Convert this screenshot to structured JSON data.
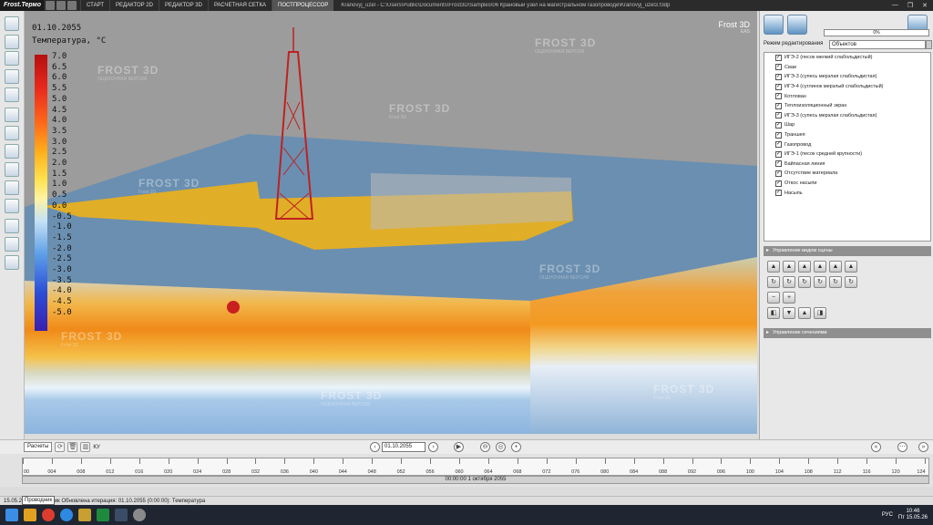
{
  "app": {
    "brand": "Frost.Термо",
    "window_title": "Kranovyj_uzel - C:\\Users\\Public\\Documents\\Frost3D\\Samples\\06 Крановый узел на магистральном газопроводе\\Kranovyj_uzel3.f3dp",
    "window_controls": [
      "—",
      "❐",
      "✕"
    ]
  },
  "tabs": [
    {
      "label": "СТАРТ"
    },
    {
      "label": "РЕДАКТОР 2D"
    },
    {
      "label": "РЕДАКТОР 3D"
    },
    {
      "label": "РАСЧЕТНАЯ СЕТКА"
    },
    {
      "label": "ПОСТПРОЦЕССОР"
    }
  ],
  "viewport": {
    "brand": "Frost 3D",
    "brand_sub": "EAS",
    "watermark": "FROST 3D",
    "watermark_sub1": "ОЦЕНОЧНАЯ ВЕРСИЯ",
    "watermark_sub2": "Frost 3D",
    "legend": {
      "date": "01.10.2055",
      "title": "Температура, °С",
      "ticks": [
        "7.0",
        "6.5",
        "6.0",
        "5.5",
        "5.0",
        "4.5",
        "4.0",
        "3.5",
        "3.0",
        "2.5",
        "2.0",
        "1.5",
        "1.0",
        "0.5",
        "0.0",
        "-0.5",
        "-1.0",
        "-1.5",
        "-2.0",
        "-2.5",
        "-3.0",
        "-3.5",
        "-4.0",
        "-4.5",
        "-5.0"
      ]
    }
  },
  "right_panel": {
    "progress": "0%",
    "mode_label": "Режим редактирования",
    "mode_value": "Объектов",
    "objects": [
      {
        "label": "ИГЭ-2 (песок мелкий слабольдистый)",
        "checked": true
      },
      {
        "label": "Сваи",
        "checked": true
      },
      {
        "label": "ИГЭ-3 (супесь мерзлая слабольдистая)",
        "checked": true
      },
      {
        "label": "ИГЭ-4 (суглинок мерзлый слабольдистый)",
        "checked": true
      },
      {
        "label": "Котлован",
        "checked": true
      },
      {
        "label": "Теплоизоляционный экран",
        "checked": true
      },
      {
        "label": "ИГЭ-3 (супесь мерзлая слабольдистая)",
        "checked": true
      },
      {
        "label": "Шар",
        "checked": true
      },
      {
        "label": "Траншея",
        "checked": true
      },
      {
        "label": "Газопровод",
        "checked": true
      },
      {
        "label": "ИГЭ-1 (песок средней крупности)",
        "checked": true
      },
      {
        "label": "Байпасная линия",
        "checked": true
      },
      {
        "label": "Отсутствие материала",
        "checked": true
      },
      {
        "label": "Откос насыпи",
        "checked": true
      },
      {
        "label": "Насыпь",
        "checked": true
      }
    ],
    "section_views": "Управление видом сцены",
    "section_cuts": "Управление сечениями"
  },
  "timebar": {
    "calc_label": "Расчеты",
    "date": "01.10.2055",
    "unit_label": "КУ"
  },
  "scale": {
    "labels": [
      "00",
      "004",
      "008",
      "012",
      "016",
      "020",
      "024",
      "028",
      "032",
      "036",
      "040",
      "044",
      "048",
      "052",
      "056",
      "060",
      "064",
      "068",
      "072",
      "076",
      "080",
      "084",
      "088",
      "092",
      "096",
      "100",
      "104",
      "108",
      "112",
      "116",
      "120",
      "124"
    ],
    "current": "00:00:00 1 октября 2055"
  },
  "status": {
    "text": "15.05.2026 Проводник  Обновлена итерация: 01.10.2055 (0:00:00): Температура",
    "tooltip": "Проводник"
  },
  "taskbar": {
    "lang": "РУС",
    "time": "10:46",
    "date": "Пт 15.05.26"
  }
}
